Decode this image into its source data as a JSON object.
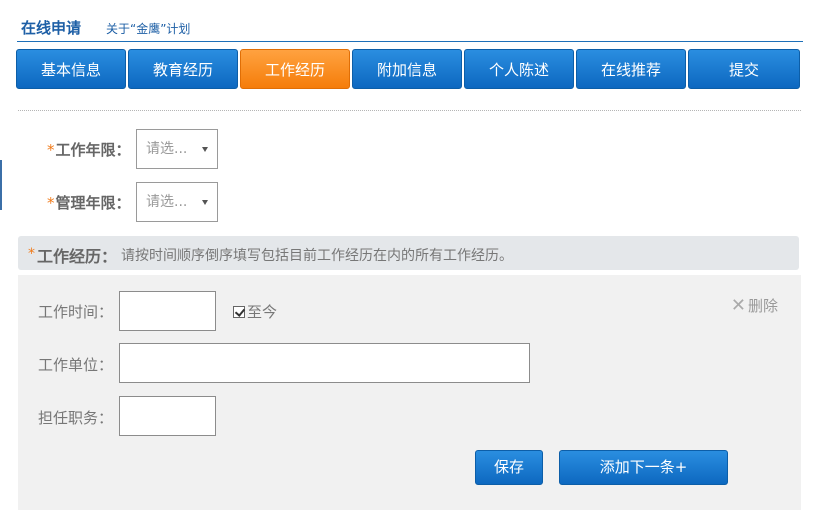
{
  "header": {
    "title": "在线申请",
    "subtitle": "关于“金鹰”计划"
  },
  "tabs": [
    {
      "label": "基本信息"
    },
    {
      "label": "教育经历"
    },
    {
      "label": "工作经历",
      "active": true
    },
    {
      "label": "附加信息"
    },
    {
      "label": "个人陈述"
    },
    {
      "label": "在线推荐"
    },
    {
      "label": "提交"
    }
  ],
  "form": {
    "required_mark": "*",
    "work_years": {
      "label": "工作年限：",
      "value": "请选..."
    },
    "manage_years": {
      "label": "管理年限：",
      "value": "请选..."
    }
  },
  "section": {
    "title": "工作经历：",
    "description": "请按时间顺序倒序填写包括目前工作经历在内的所有工作经历。"
  },
  "entry": {
    "time_label": "工作时间：",
    "time_value": "",
    "until_now_label": "至今",
    "until_now_checked": true,
    "company_label": "工作单位：",
    "company_value": "",
    "position_label": "担任职务：",
    "position_value": "",
    "delete_label": "删除"
  },
  "buttons": {
    "save": "保存",
    "add_next": "添加下一条+"
  },
  "colors": {
    "tab_blue": "#0d68c0",
    "tab_active": "#f57d0a",
    "required": "#f07a1a"
  }
}
